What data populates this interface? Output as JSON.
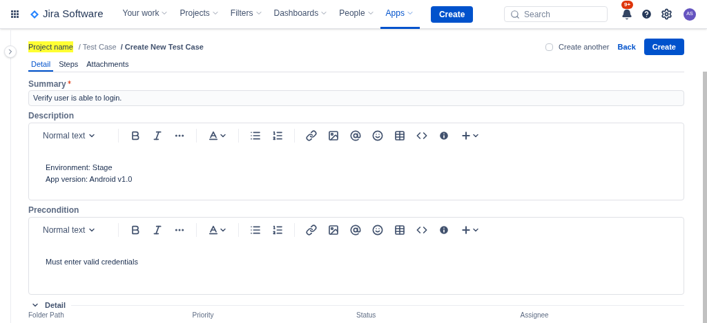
{
  "nav": {
    "product": "Jira Software",
    "items": [
      {
        "label": "Your work",
        "selected": false
      },
      {
        "label": "Projects",
        "selected": false
      },
      {
        "label": "Filters",
        "selected": false
      },
      {
        "label": "Dashboards",
        "selected": false
      },
      {
        "label": "People",
        "selected": false
      },
      {
        "label": "Apps",
        "selected": true
      }
    ],
    "create_button": "Create",
    "search": {
      "placeholder": "Search"
    },
    "notification_badge": "9+",
    "avatar": "AS"
  },
  "breadcrumb": {
    "project": "Project name",
    "items": [
      "/ Test Case",
      "/ Create New Test Case"
    ]
  },
  "actions": {
    "create_another": {
      "label": "Create another",
      "checked": false
    },
    "back": "Back",
    "create": "Create"
  },
  "tabs": [
    {
      "label": "Detail",
      "selected": true
    },
    {
      "label": "Steps",
      "selected": false
    },
    {
      "label": "Attachments",
      "selected": false
    }
  ],
  "summary": {
    "label": "Summary",
    "required": true,
    "value": "Verify user is able to login."
  },
  "editors": [
    {
      "label": "Description",
      "text_style": "Normal text",
      "lines": [
        "Environment: Stage",
        "App version: Android v1.0"
      ]
    },
    {
      "label": "Precondition",
      "text_style": "Normal text",
      "lines": [
        "Must enter valid credentials"
      ]
    }
  ],
  "detail_section": {
    "label": "Detail",
    "expanded": true,
    "columns": [
      "Folder Path",
      "Priority",
      "Status",
      "Assignee"
    ]
  }
}
